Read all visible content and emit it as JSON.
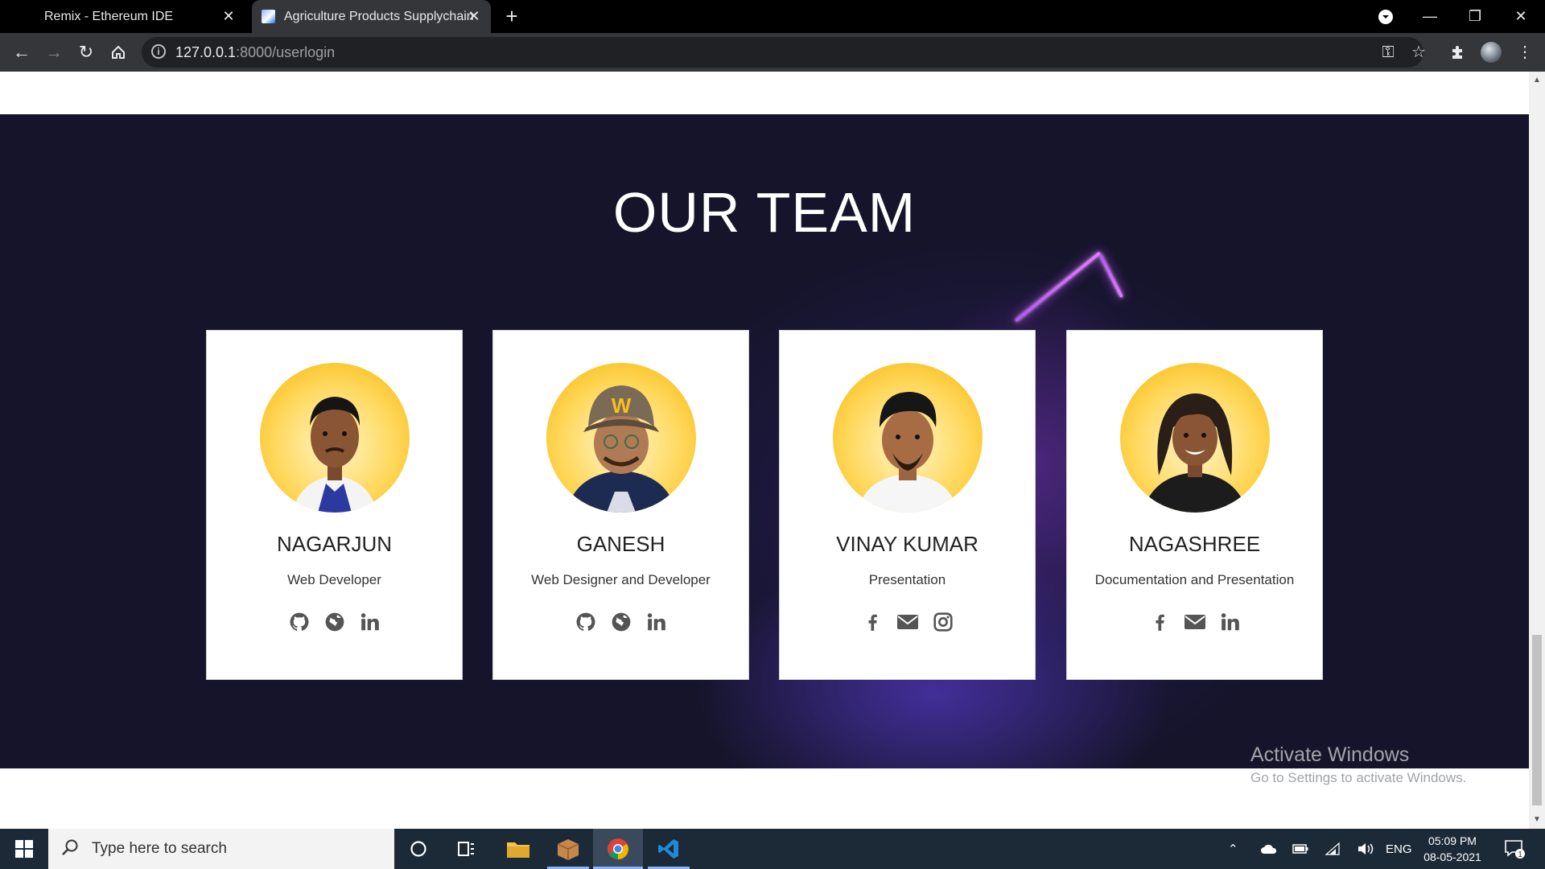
{
  "browser": {
    "tabs": [
      {
        "title": "Remix - Ethereum IDE",
        "active": false
      },
      {
        "title": "Agriculture Products Supplychain",
        "active": true
      }
    ],
    "url_host": "127.0.0.1",
    "url_rest": ":8000/userlogin"
  },
  "page": {
    "section_title": "OUR TEAM",
    "members": [
      {
        "name": "NAGARJUN",
        "role": "Web Developer",
        "socials": [
          "github-icon",
          "globe-icon",
          "linkedin-icon"
        ]
      },
      {
        "name": "GANESH",
        "role": "Web Designer and Developer",
        "socials": [
          "github-icon",
          "globe-icon",
          "linkedin-icon"
        ]
      },
      {
        "name": "VINAY KUMAR",
        "role": "Presentation",
        "socials": [
          "facebook-icon",
          "envelope-icon",
          "instagram-icon"
        ]
      },
      {
        "name": "NAGASHREE",
        "role": "Documentation and Presentation",
        "socials": [
          "facebook-icon",
          "envelope-icon",
          "linkedin-icon"
        ]
      }
    ]
  },
  "watermark": {
    "line1": "Activate Windows",
    "line2": "Go to Settings to activate Windows."
  },
  "taskbar": {
    "search_placeholder": "Type here to search",
    "language": "ENG",
    "time": "05:09 PM",
    "date": "08-05-2021",
    "notification_count": "1"
  },
  "colors": {
    "section_background": "#16142b",
    "accent_neon": "#c05cff",
    "taskbar": "#1c2a38"
  }
}
